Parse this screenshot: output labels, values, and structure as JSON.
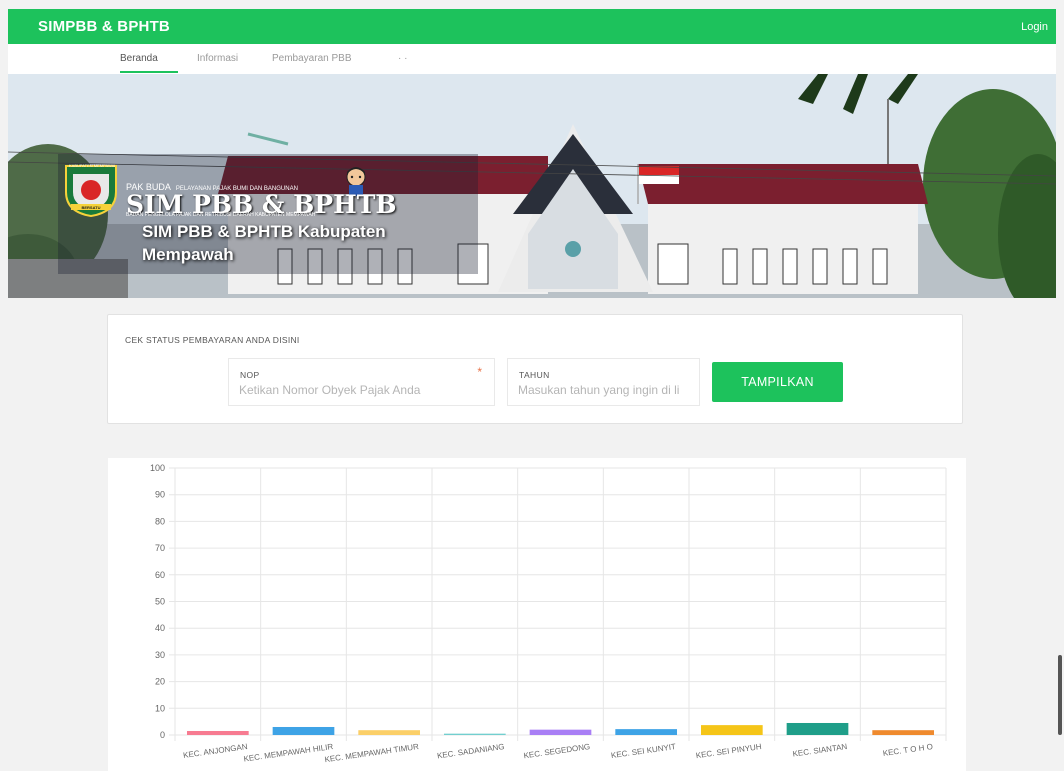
{
  "header": {
    "brand": "SIMPBB & BPHTB",
    "login_label": "Login",
    "accent_color": "#1dc25c"
  },
  "nav": {
    "items": [
      {
        "label": "Beranda",
        "active": true
      },
      {
        "label": "Informasi",
        "active": false
      },
      {
        "label": "Pembayaran PBB",
        "active": false
      },
      {
        "label": "· ·",
        "active": false
      }
    ]
  },
  "banner": {
    "small_caption": "PAK BUDA",
    "small_caption_sub": "PELAYANAN PAJAK BUMI DAN BANGUNAN",
    "logo_title": "SIM PBB & BPHTB",
    "logo_sub": "BADAN PENGELOLA PAJAK DAN RETRIBUSI DAERAH KABUPATEN MEMPAWAH",
    "title_line1": "SIM PBB & BPHTB Kabupaten",
    "title_line2": "Mempawah",
    "seal_text": "KABUPATEN MEMPAWAH",
    "seal_motto": "BERSATU"
  },
  "check": {
    "title": "CEK STATUS PEMBAYARAN ANDA DISINI",
    "nop_label": "NOP",
    "nop_placeholder": "Ketikan Nomor Obyek Pajak Anda",
    "nop_required": "*",
    "tahun_label": "TAHUN",
    "tahun_placeholder": "Masukan tahun yang ingin di li",
    "button_label": "TAMPILKAN"
  },
  "chart_data": {
    "type": "bar",
    "categories": [
      "KEC. ANJONGAN",
      "KEC. MEMPAWAH HILIR",
      "KEC. MEMPAWAH TIMUR",
      "KEC. SADANIANG",
      "KEC. SEGEDONG",
      "KEC. SEI KUNYIT",
      "KEC. SEI PINYUH",
      "KEC. SIANTAN",
      "KEC. T O H O"
    ],
    "values": [
      1.5,
      3,
      1.8,
      0.5,
      2,
      2.2,
      3.7,
      4.5,
      1.8
    ],
    "colors": [
      "#f77b91",
      "#3ea3e6",
      "#fbcf68",
      "#72cfcf",
      "#a97ff5",
      "#3ea3e6",
      "#f5c518",
      "#1f9e89",
      "#ef8a2e"
    ],
    "yticks": [
      "0",
      "10",
      "20",
      "30",
      "40",
      "50",
      "60",
      "70",
      "80",
      "90",
      "100"
    ],
    "ylim": [
      0,
      100
    ],
    "grid": true,
    "title": "",
    "xlabel": "",
    "ylabel": ""
  }
}
